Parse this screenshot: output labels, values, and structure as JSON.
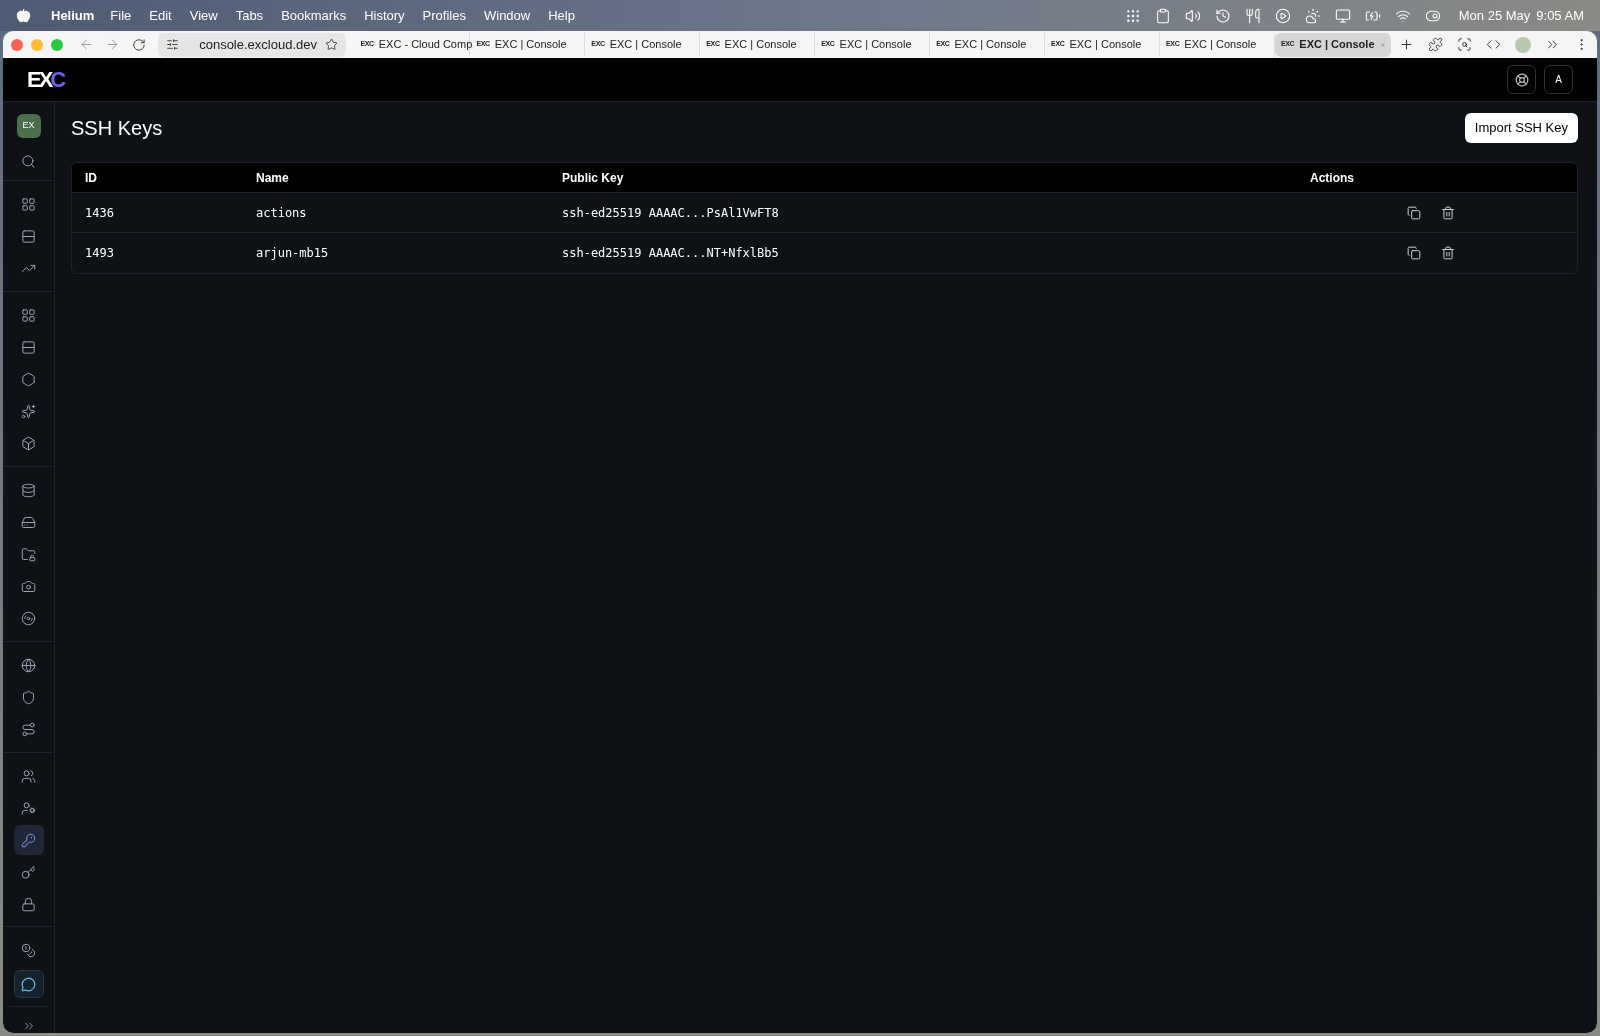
{
  "menu_bar": {
    "app": "Helium",
    "items": [
      "File",
      "Edit",
      "View",
      "Tabs",
      "Bookmarks",
      "History",
      "Profiles",
      "Window",
      "Help"
    ],
    "date": "Mon 25 May",
    "time": "9:05 AM"
  },
  "browser": {
    "address": "console.excloud.dev",
    "tabs": [
      {
        "favicon": "EXC",
        "title": "EXC - Cloud Comp",
        "selected": false
      },
      {
        "favicon": "EXC",
        "title": "EXC | Console",
        "selected": false
      },
      {
        "favicon": "EXC",
        "title": "EXC | Console",
        "selected": false
      },
      {
        "favicon": "EXC",
        "title": "EXC | Console",
        "selected": false
      },
      {
        "favicon": "EXC",
        "title": "EXC | Console",
        "selected": false
      },
      {
        "favicon": "EXC",
        "title": "EXC | Console",
        "selected": false
      },
      {
        "favicon": "EXC",
        "title": "EXC | Console",
        "selected": false
      },
      {
        "favicon": "EXC",
        "title": "EXC | Console",
        "selected": false
      },
      {
        "favicon": "EXC",
        "title": "EXC | Console",
        "selected": true
      }
    ]
  },
  "header": {
    "logo": {
      "main": "EX",
      "accent": "C"
    },
    "avatar": "A"
  },
  "sidebar": {
    "workspace": "EX",
    "groups": [
      {
        "items": [
          {
            "selected": false
          },
          {
            "selected": false
          },
          {
            "selected": false
          }
        ]
      },
      {
        "items": [
          {
            "selected": false
          },
          {
            "selected": false
          },
          {
            "selected": false
          },
          {
            "selected": false
          },
          {
            "selected": false
          }
        ]
      },
      {
        "items": [
          {
            "selected": false
          },
          {
            "selected": false
          },
          {
            "selected": false
          },
          {
            "selected": false
          },
          {
            "selected": false
          }
        ]
      },
      {
        "items": [
          {
            "selected": false
          },
          {
            "selected": false
          },
          {
            "selected": false
          }
        ]
      },
      {
        "items": [
          {
            "selected": false
          },
          {
            "selected": false
          },
          {
            "selected": true
          },
          {
            "selected": false
          },
          {
            "selected": false
          }
        ]
      }
    ],
    "chat_open": true
  },
  "page": {
    "title": "SSH Keys",
    "import_button": "Import SSH Key"
  },
  "table": {
    "columns": [
      "ID",
      "Name",
      "Public Key",
      "Actions"
    ],
    "rows": [
      {
        "id": "1436",
        "name": "actions",
        "public_key": "ssh-ed25519 AAAAC...PsAl1VwFT8"
      },
      {
        "id": "1493",
        "name": "arjun-mb15",
        "public_key": "ssh-ed25519 AAAAC...NT+NfxlBb5"
      }
    ]
  }
}
